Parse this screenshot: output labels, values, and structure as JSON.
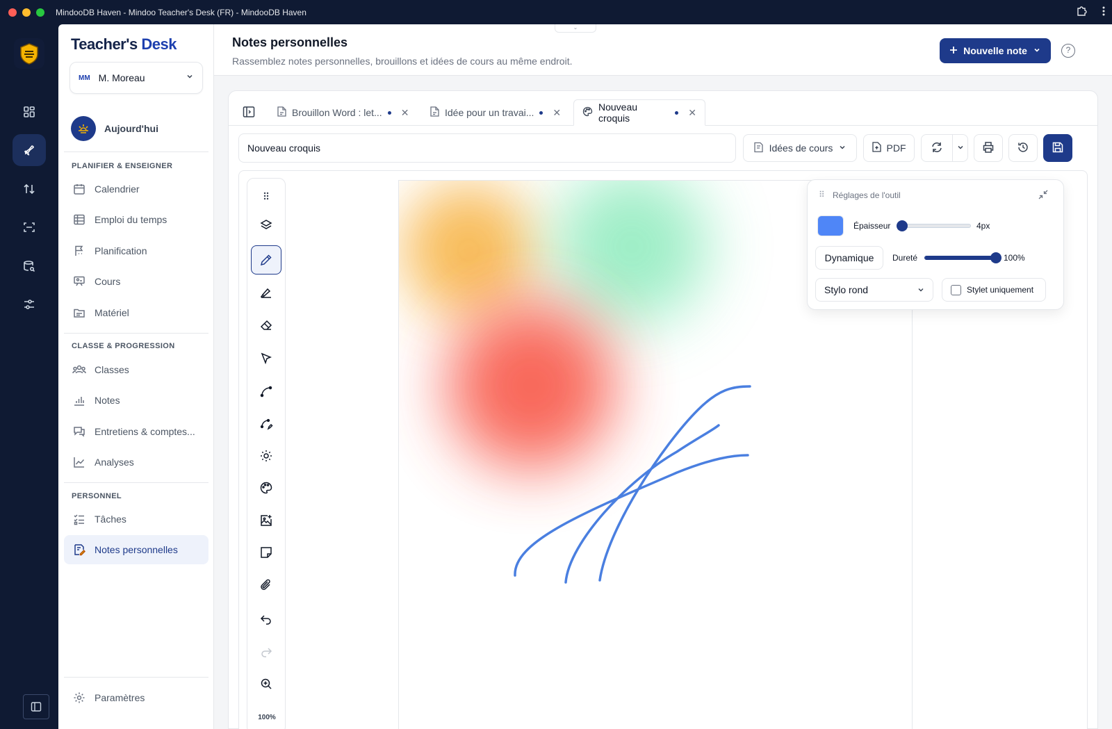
{
  "window": {
    "title": "MindooDB Haven - Mindoo Teacher's Desk (FR) - MindooDB Haven"
  },
  "brand": {
    "part1": "Teacher's",
    "part2": "Desk"
  },
  "user": {
    "initials": "MM",
    "name": "M. Moreau"
  },
  "sidebar": {
    "today": "Aujourd'hui",
    "sections": [
      {
        "title": "PLANIFIER & ENSEIGNER",
        "items": [
          {
            "label": "Calendrier"
          },
          {
            "label": "Emploi du temps"
          },
          {
            "label": "Planification"
          },
          {
            "label": "Cours"
          },
          {
            "label": "Matériel"
          }
        ]
      },
      {
        "title": "CLASSE & PROGRESSION",
        "items": [
          {
            "label": "Classes"
          },
          {
            "label": "Notes"
          },
          {
            "label": "Entretiens & comptes..."
          },
          {
            "label": "Analyses"
          }
        ]
      },
      {
        "title": "PERSONNEL",
        "items": [
          {
            "label": "Tâches"
          },
          {
            "label": "Notes personnelles"
          }
        ]
      }
    ],
    "settings": "Paramètres"
  },
  "header": {
    "title": "Notes personnelles",
    "subtitle": "Rassemblez notes personnelles, brouillons et idées de cours au même endroit.",
    "new_note": "Nouvelle note"
  },
  "tabs": [
    {
      "label": "Brouillon Word : let...",
      "unsaved": true
    },
    {
      "label": "Idée pour un travai...",
      "unsaved": true
    },
    {
      "label": "Nouveau croquis",
      "unsaved": true,
      "active": true
    }
  ],
  "toolbar": {
    "title_value": "Nouveau croquis",
    "category": "Idées de cours",
    "pdf": "PDF"
  },
  "canvas": {
    "zoom": "100%"
  },
  "tool_settings": {
    "title": "Réglages de l'outil",
    "color": "#4f86f7",
    "thickness_label": "Épaisseur",
    "thickness_value": "4px",
    "thickness_fraction": 0.06,
    "dynamic": "Dynamique",
    "hardness_label": "Dureté",
    "hardness_value": "100%",
    "hardness_fraction": 1.0,
    "brush": "Stylo rond",
    "stylus_only": "Stylet uniquement"
  },
  "colors": {
    "accent": "#1e3a8a",
    "rail": "#0f1a33"
  }
}
